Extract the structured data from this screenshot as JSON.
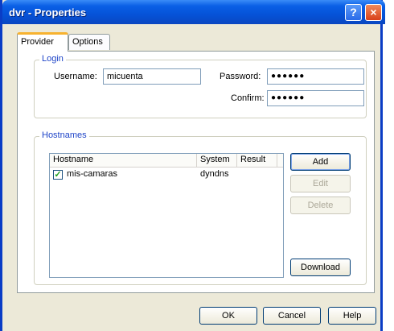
{
  "window": {
    "title": "dvr - Properties",
    "help_glyph": "?",
    "close_glyph": "×"
  },
  "tabs": [
    {
      "label": "Provider",
      "active": true
    },
    {
      "label": "Options",
      "active": false
    }
  ],
  "login": {
    "legend": "Login",
    "username_label": "Username:",
    "username_value": "micuenta",
    "password_label": "Password:",
    "password_value": "●●●●●●",
    "confirm_label": "Confirm:",
    "confirm_value": "●●●●●●"
  },
  "hostnames": {
    "legend": "Hostnames",
    "columns": [
      "Hostname",
      "System",
      "Result"
    ],
    "rows": [
      {
        "checked": true,
        "hostname": "mis-camaras",
        "system": "dyndns",
        "result": ""
      }
    ],
    "buttons": {
      "add": "Add",
      "edit": "Edit",
      "delete": "Delete",
      "download": "Download"
    }
  },
  "dialog_buttons": {
    "ok": "OK",
    "cancel": "Cancel",
    "help": "Help"
  },
  "colors": {
    "titlebar": "#0553d8",
    "group_legend": "#1e44c8",
    "tab_highlight": "#f7b22f",
    "checkbox_mark": "#21a121"
  }
}
